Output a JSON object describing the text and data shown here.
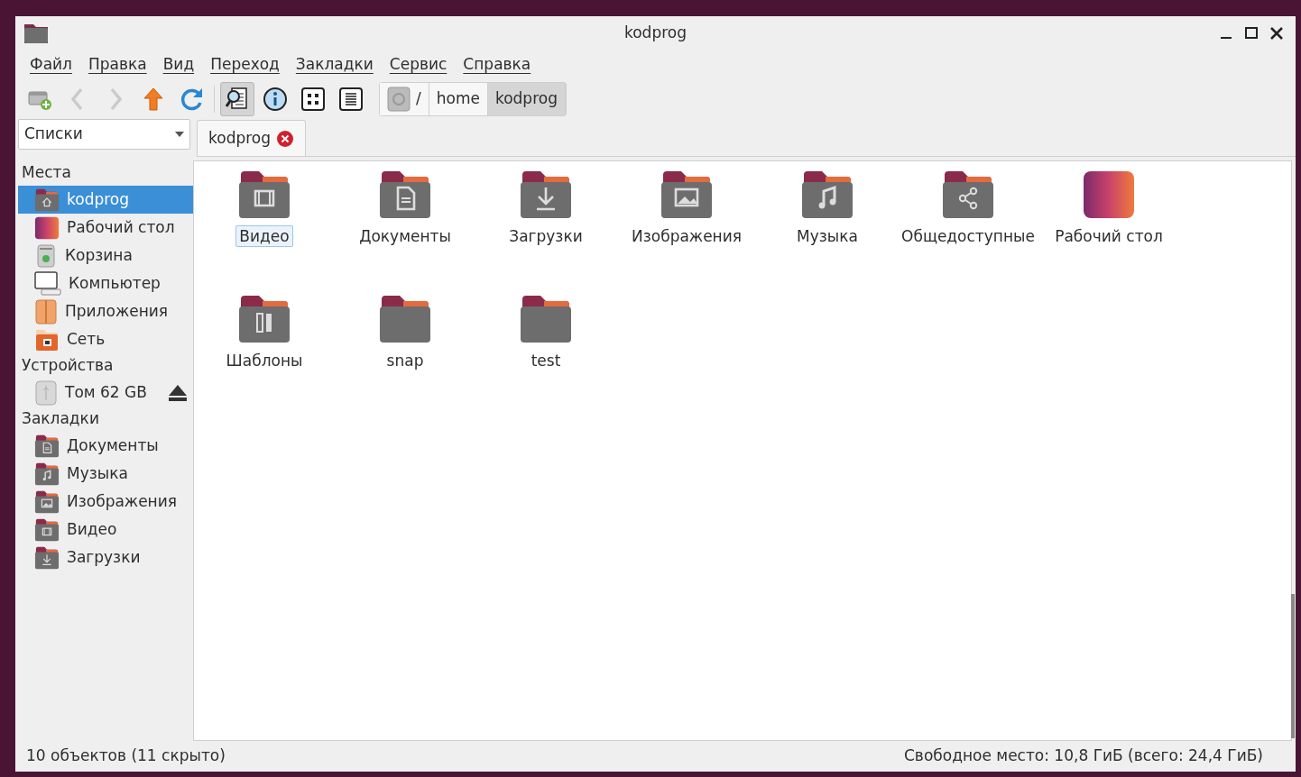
{
  "window": {
    "title": "kodprog"
  },
  "menu": [
    "Файл",
    "Правка",
    "Вид",
    "Переход",
    "Закладки",
    "Сервис",
    "Справка"
  ],
  "toolbar": [
    {
      "kind": "new-tab",
      "pressed": false,
      "disabled": false
    },
    {
      "kind": "back",
      "pressed": false,
      "disabled": true
    },
    {
      "kind": "forward",
      "pressed": false,
      "disabled": true
    },
    {
      "kind": "up",
      "pressed": false,
      "disabled": false
    },
    {
      "kind": "reload",
      "pressed": false,
      "disabled": false
    },
    {
      "kind": "sep"
    },
    {
      "kind": "preview",
      "pressed": true,
      "disabled": false
    },
    {
      "kind": "info",
      "pressed": false,
      "disabled": false
    },
    {
      "kind": "icons",
      "pressed": false,
      "disabled": false
    },
    {
      "kind": "list",
      "pressed": false,
      "disabled": false
    }
  ],
  "path": [
    {
      "kind": "root",
      "label": "/",
      "selected": false
    },
    {
      "kind": "dir",
      "label": "home",
      "selected": false
    },
    {
      "kind": "dir",
      "label": "kodprog",
      "selected": true
    }
  ],
  "side_pane_mode": "Списки",
  "tabs": [
    {
      "label": "kodprog",
      "selected": true
    }
  ],
  "sidebar": [
    {
      "header": "Места",
      "items": [
        {
          "kind": "home",
          "label": "kodprog",
          "selected": true
        },
        {
          "kind": "desktop",
          "label": "Рабочий стол",
          "selected": false
        },
        {
          "kind": "trash",
          "label": "Корзина",
          "selected": false
        },
        {
          "kind": "computer",
          "label": "Компьютер",
          "selected": false
        },
        {
          "kind": "apps",
          "label": "Приложения",
          "selected": false
        },
        {
          "kind": "network",
          "label": "Сеть",
          "selected": false
        }
      ]
    },
    {
      "header": "Устройства",
      "items": [
        {
          "kind": "usb",
          "label": "Том 62 GB",
          "selected": false,
          "eject": true
        }
      ]
    },
    {
      "header": "Закладки",
      "items": [
        {
          "kind": "documents",
          "label": "Документы",
          "selected": false
        },
        {
          "kind": "music",
          "label": "Музыка",
          "selected": false
        },
        {
          "kind": "pictures",
          "label": "Изображения",
          "selected": false
        },
        {
          "kind": "videos",
          "label": "Видео",
          "selected": false
        },
        {
          "kind": "downloads",
          "label": "Загрузки",
          "selected": false
        }
      ]
    }
  ],
  "files": [
    {
      "kind": "videos",
      "label": "Видео",
      "selected": true
    },
    {
      "kind": "documents",
      "label": "Документы",
      "selected": false
    },
    {
      "kind": "downloads",
      "label": "Загрузки",
      "selected": false
    },
    {
      "kind": "pictures",
      "label": "Изображения",
      "selected": false
    },
    {
      "kind": "music",
      "label": "Музыка",
      "selected": false
    },
    {
      "kind": "public",
      "label": "Общедоступные",
      "selected": false
    },
    {
      "kind": "desktop",
      "label": "Рабочий стол",
      "selected": false
    },
    {
      "kind": "templates",
      "label": "Шаблоны",
      "selected": false
    },
    {
      "kind": "plain",
      "label": "snap",
      "selected": false
    },
    {
      "kind": "plain",
      "label": "test",
      "selected": false
    }
  ],
  "status_bar": {
    "left": "10 объектов (11 скрыто)",
    "right": "Свободное место: 10,8 ГиБ (всего: 24,4 ГиБ)"
  }
}
